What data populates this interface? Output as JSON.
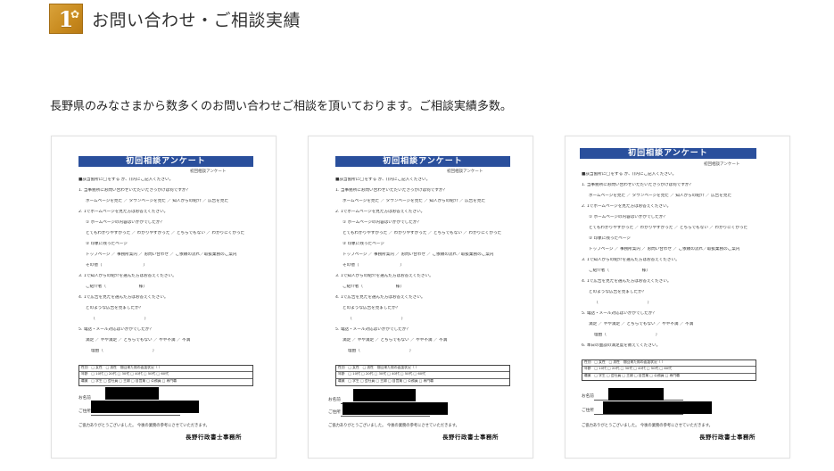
{
  "header": {
    "number": "1",
    "title": "お問い合わせ・ご相談実績"
  },
  "intro": "長野県のみなさまから数多くのお問い合わせご相談を頂いております。ご相談実績多数。",
  "survey": {
    "title": "初回相談アンケート",
    "subtitle": "初回相談アンケート",
    "lines": [
      "■該当箇所に◯をする か、()内にご記入ください。",
      "1. 当事務所にお問い合わせいただいたきっかけは何ですか？",
      "ホームページを見た ／ タウンページを見た ／ 知人からの紹介 ／ 広告を見た",
      "2. 1でホームページを見た方はお答えください。",
      "① ホームページの内容はいかがでしたか？",
      "とてもわかりやすかった ／ わかりやすかった ／ どちらでもない ／ わかりにくかった",
      "② 印象に残ったページ",
      "トップページ ／ 事務所案内 ／ お問い合わせ ／ ご依頼の流れ／取扱業務のご案内",
      "その他（　　　　　　　　　　）",
      "3. 1で知人からの紹介を選んだ方はお答えください。",
      "ご紹介者（　　　　　　　　様）",
      "4. 1で広告を見たを選んだ方はお答えください。",
      "どのような広告を見ましたか？",
      "（　　　　　　　　　　　　）",
      "5. 電話・メール対応はいかがでしたか？",
      "満足 ／ やや満足 ／ どちらでもない ／ やや不満 ／ 不満",
      "理由（　　　　　　　　　　　　）",
      "6. 本日の面談の満足度を教えてください。",
      "満足 ／ やや満足 ／ どちらでもない ／ やや不満 ／ 不満",
      "理由（　　　　　　　　　　　　）"
    ],
    "table_rows": [
      "性別　□ 女性　□ 男性　前回来た際の面談状況（ ）",
      "年齢　□ 10代 □ 20代 □ 30代 □ 40代 □ 50代 □ 60代",
      "職業　□ 学生 □ 会社員 □ 主婦 □ 自営業 □ 公務員 □ 専門職"
    ],
    "name_label": "お名前",
    "address_label": "ご住所",
    "thanks": "ご協力ありがとうございました。 今後の業務の参考にさせていただきます。",
    "office": "長野行政書士事務所"
  }
}
